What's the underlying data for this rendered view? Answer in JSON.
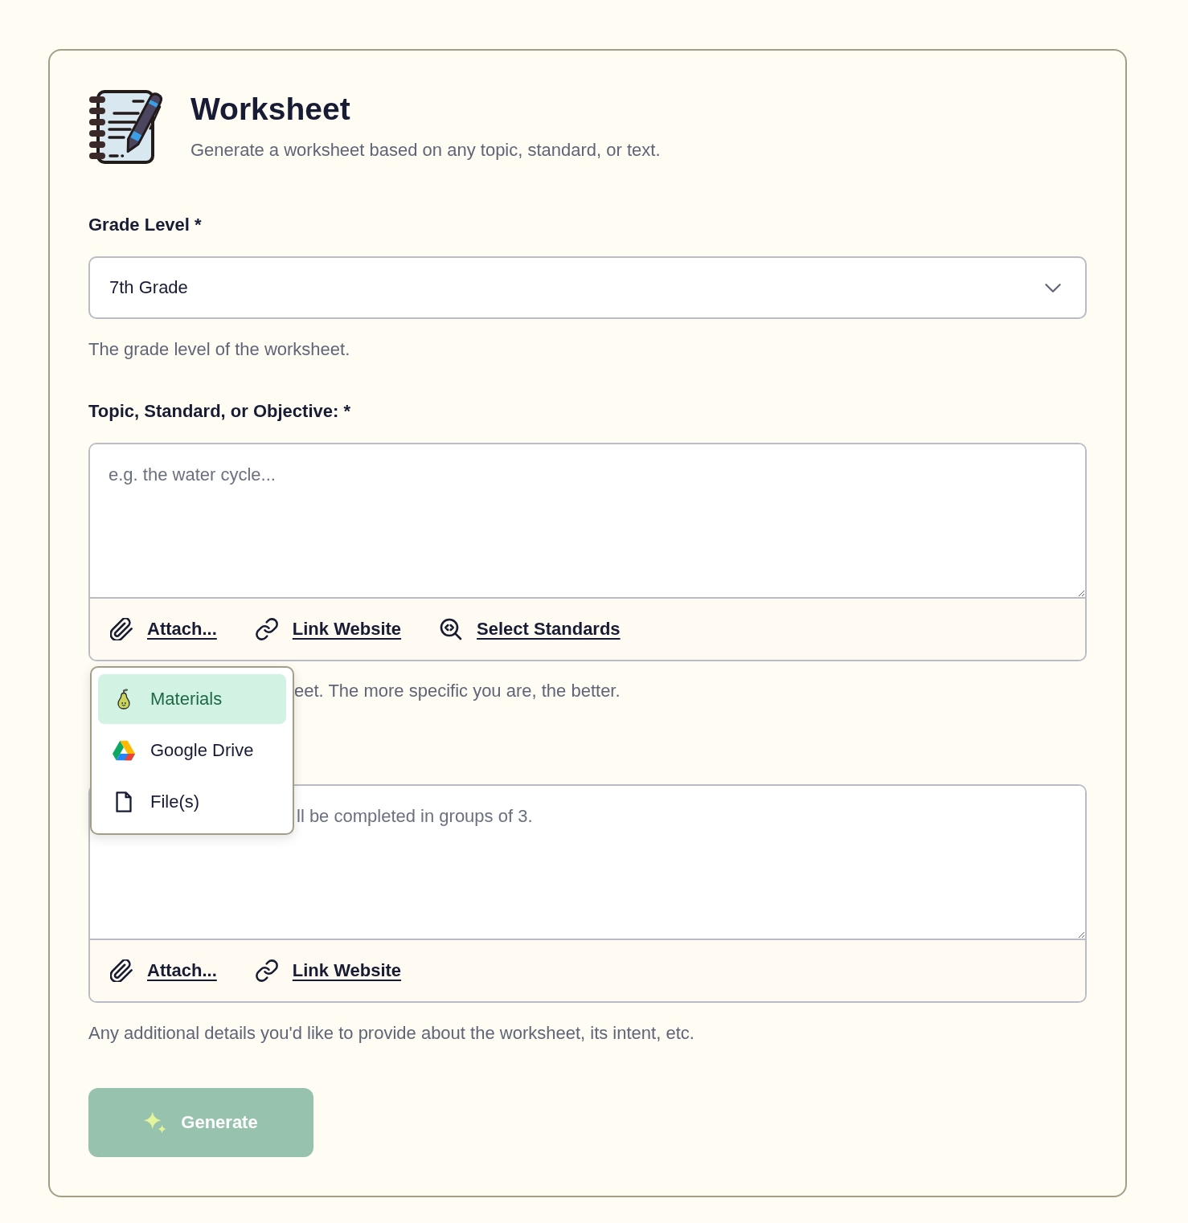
{
  "header": {
    "title": "Worksheet",
    "subtitle": "Generate a worksheet based on any topic, standard, or text."
  },
  "fields": [
    {
      "kind": "select",
      "label": "Grade Level *",
      "value": "7th Grade",
      "hint": "The grade level of the worksheet."
    },
    {
      "kind": "textarea",
      "label": "Topic, Standard, or Objective: *",
      "placeholder": "e.g. the water cycle...",
      "tools": [
        {
          "kind": "attach",
          "label": "Attach..."
        },
        {
          "kind": "link",
          "label": "Link Website"
        },
        {
          "kind": "standards",
          "label": "Select Standards"
        }
      ],
      "menu": [
        {
          "kind": "pear",
          "label": "Materials",
          "selected": true
        },
        {
          "kind": "drive",
          "label": "Google Drive",
          "selected": false
        },
        {
          "kind": "file",
          "label": "File(s)",
          "selected": false
        }
      ],
      "hint": "eet. The more specific you are, the better."
    },
    {
      "kind": "textarea",
      "placeholder": "ll be completed in groups of 3.",
      "tools": [
        {
          "kind": "attach",
          "label": "Attach..."
        },
        {
          "kind": "link",
          "label": "Link Website"
        }
      ],
      "hint": "Any additional details you'd like to provide about the worksheet, its intent, etc."
    }
  ],
  "generate_button": {
    "label": "Generate",
    "disabled": true
  }
}
